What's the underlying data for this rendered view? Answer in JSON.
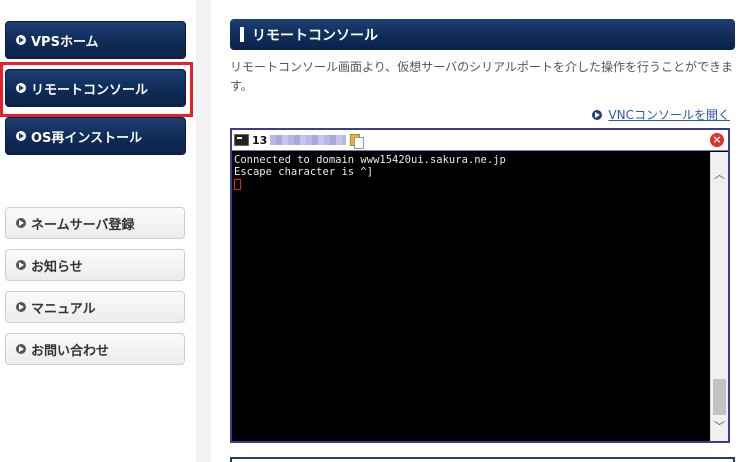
{
  "sidebar": {
    "primary_items": [
      {
        "label": "VPSホーム"
      },
      {
        "label": "リモートコンソール"
      },
      {
        "label": "OS再インストール"
      }
    ],
    "secondary_items": [
      {
        "label": "ネームサーバ登録"
      },
      {
        "label": "お知らせ"
      },
      {
        "label": "マニュアル"
      },
      {
        "label": "お問い合わせ"
      }
    ]
  },
  "main": {
    "title": "リモートコンソール",
    "description": "リモートコンソール画面より、仮想サーバのシリアルポートを介した操作を行うことができます。",
    "vnc_link": "VNCコンソールを開く"
  },
  "console": {
    "title_prefix": "13",
    "lines": [
      "Connected to domain www15420ui.sakura.ne.jp",
      "Escape character is ^]"
    ]
  },
  "colors": {
    "navy": "#0f2b57",
    "highlight": "#e8202a",
    "link": "#2a5aa8"
  }
}
